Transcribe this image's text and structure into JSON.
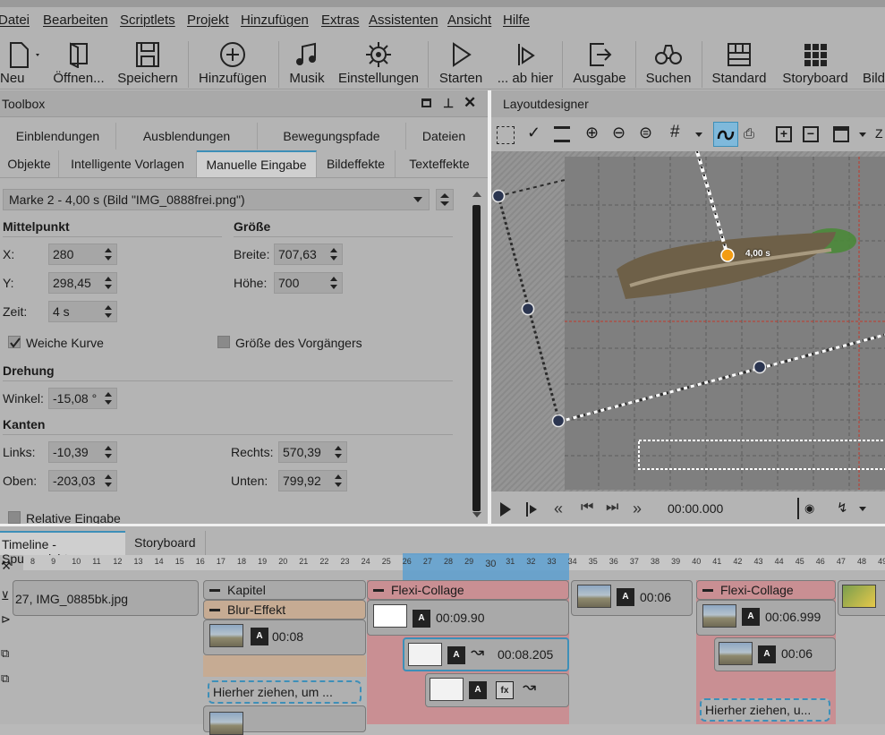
{
  "menu": [
    "Datei",
    "Bearbeiten",
    "Scriptlets",
    "Projekt",
    "Hinzufügen",
    "Extras",
    "Assistenten",
    "Ansicht",
    "Hilfe"
  ],
  "toolbar": {
    "new": "Neu",
    "open": "Öffnen...",
    "save": "Speichern",
    "add": "Hinzufügen",
    "music": "Musik",
    "settings": "Einstellungen",
    "start": "Starten",
    "from_here": "... ab hier",
    "output": "Ausgabe",
    "search": "Suchen",
    "standard": "Standard",
    "storyboard": "Storyboard",
    "image": "Bild"
  },
  "toolbox": {
    "title": "Toolbox",
    "tabs_row1": [
      "Einblendungen",
      "Ausblendungen",
      "Bewegungspfade",
      "Dateien"
    ],
    "tabs_row2": [
      "Objekte",
      "Intelligente Vorlagen",
      "Manuelle Eingabe",
      "Bildeffekte",
      "Texteffekte"
    ],
    "marker_select": "Marke 2 - 4,00 s (Bild \"IMG_0888frei.png\")",
    "mittelpunkt": "Mittelpunkt",
    "groesse": "Größe",
    "x_label": "X:",
    "x_value": "280",
    "y_label": "Y:",
    "y_value": "298,45",
    "zeit_label": "Zeit:",
    "zeit_value": "4 s",
    "breite_label": "Breite:",
    "breite_value": "707,63",
    "hoehe_label": "Höhe:",
    "hoehe_value": "700",
    "weiche_kurve": "Weiche Kurve",
    "groesse_vorgaenger": "Größe des Vorgängers",
    "drehung": "Drehung",
    "winkel_label": "Winkel:",
    "winkel_value": "-15,08 °",
    "kanten": "Kanten",
    "links_label": "Links:",
    "links_value": "-10,39",
    "oben_label": "Oben:",
    "oben_value": "-203,03",
    "rechts_label": "Rechts:",
    "rechts_value": "570,39",
    "unten_label": "Unten:",
    "unten_value": "799,92",
    "relative": "Relative Eingabe"
  },
  "layoutdesigner": {
    "title": "Layoutdesigner",
    "marker_time": "4,00 s",
    "time": "00:00.000",
    "zoom_letter": "Z"
  },
  "timeline": {
    "tab_active": "Timeline - Spuransicht",
    "tab_other": "Storyboard",
    "ruler": [
      "8",
      "9",
      "10",
      "11",
      "12",
      "13",
      "14",
      "15",
      "16",
      "17",
      "18",
      "19",
      "20",
      "21",
      "22",
      "23",
      "24",
      "25",
      "26",
      "27",
      "28",
      "29",
      "30",
      "31",
      "32",
      "33",
      "34",
      "35",
      "36",
      "37",
      "38",
      "39",
      "40",
      "41",
      "42",
      "43",
      "44",
      "45",
      "46",
      "47",
      "48",
      "49"
    ],
    "clip1": "27, IMG_0885bk.jpg",
    "kapitel": "Kapitel",
    "blur": "Blur-Effekt",
    "d_0008": "00:08",
    "drop1": "Hierher ziehen, um ...",
    "flexi1": "Flexi-Collage",
    "d_00990": "00:09.90",
    "d_08205": "00:08.205",
    "d_0006a": "00:06",
    "flexi2": "Flexi-Collage",
    "d_06999": "00:06.999",
    "d_0006b": "00:06",
    "drop2": "Hierher ziehen, u..."
  },
  "colors": {
    "accent": "#3d8fb8",
    "selection": "#5d9fcf",
    "flexi": "#c98f93",
    "blur": "#c6ab93"
  }
}
